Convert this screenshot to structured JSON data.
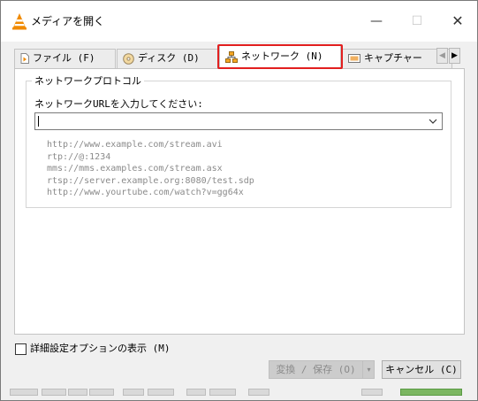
{
  "window": {
    "title": "メディアを開く",
    "controls": {
      "minimize": "—",
      "maximize": "☐",
      "close": "✕"
    }
  },
  "tabs": [
    {
      "label": "ファイル (F)",
      "icon": "file-icon",
      "active": false
    },
    {
      "label": "ディスク (D)",
      "icon": "disc-icon",
      "active": false
    },
    {
      "label": "ネットワーク (N)",
      "icon": "network-icon",
      "active": true
    },
    {
      "label": "キャプチャー",
      "icon": "capture-icon",
      "active": false
    }
  ],
  "tab_scroll": {
    "left": "◀",
    "right": "▶"
  },
  "highlight_color": "#e21f1f",
  "network": {
    "group_title": "ネットワークプロトコル",
    "url_label": "ネットワークURLを入力してください:",
    "url_value": "",
    "examples": [
      "http://www.example.com/stream.avi",
      "rtp://@:1234",
      "mms://mms.examples.com/stream.asx",
      "rtsp://server.example.org:8080/test.sdp",
      "http://www.yourtube.com/watch?v=gg64x"
    ]
  },
  "advanced_options": {
    "label": "詳細設定オプションの表示 (M)",
    "checked": false
  },
  "buttons": {
    "convert": "変換 / 保存 (O)",
    "convert_dropdown": "▾",
    "cancel": "キャンセル (C)"
  }
}
